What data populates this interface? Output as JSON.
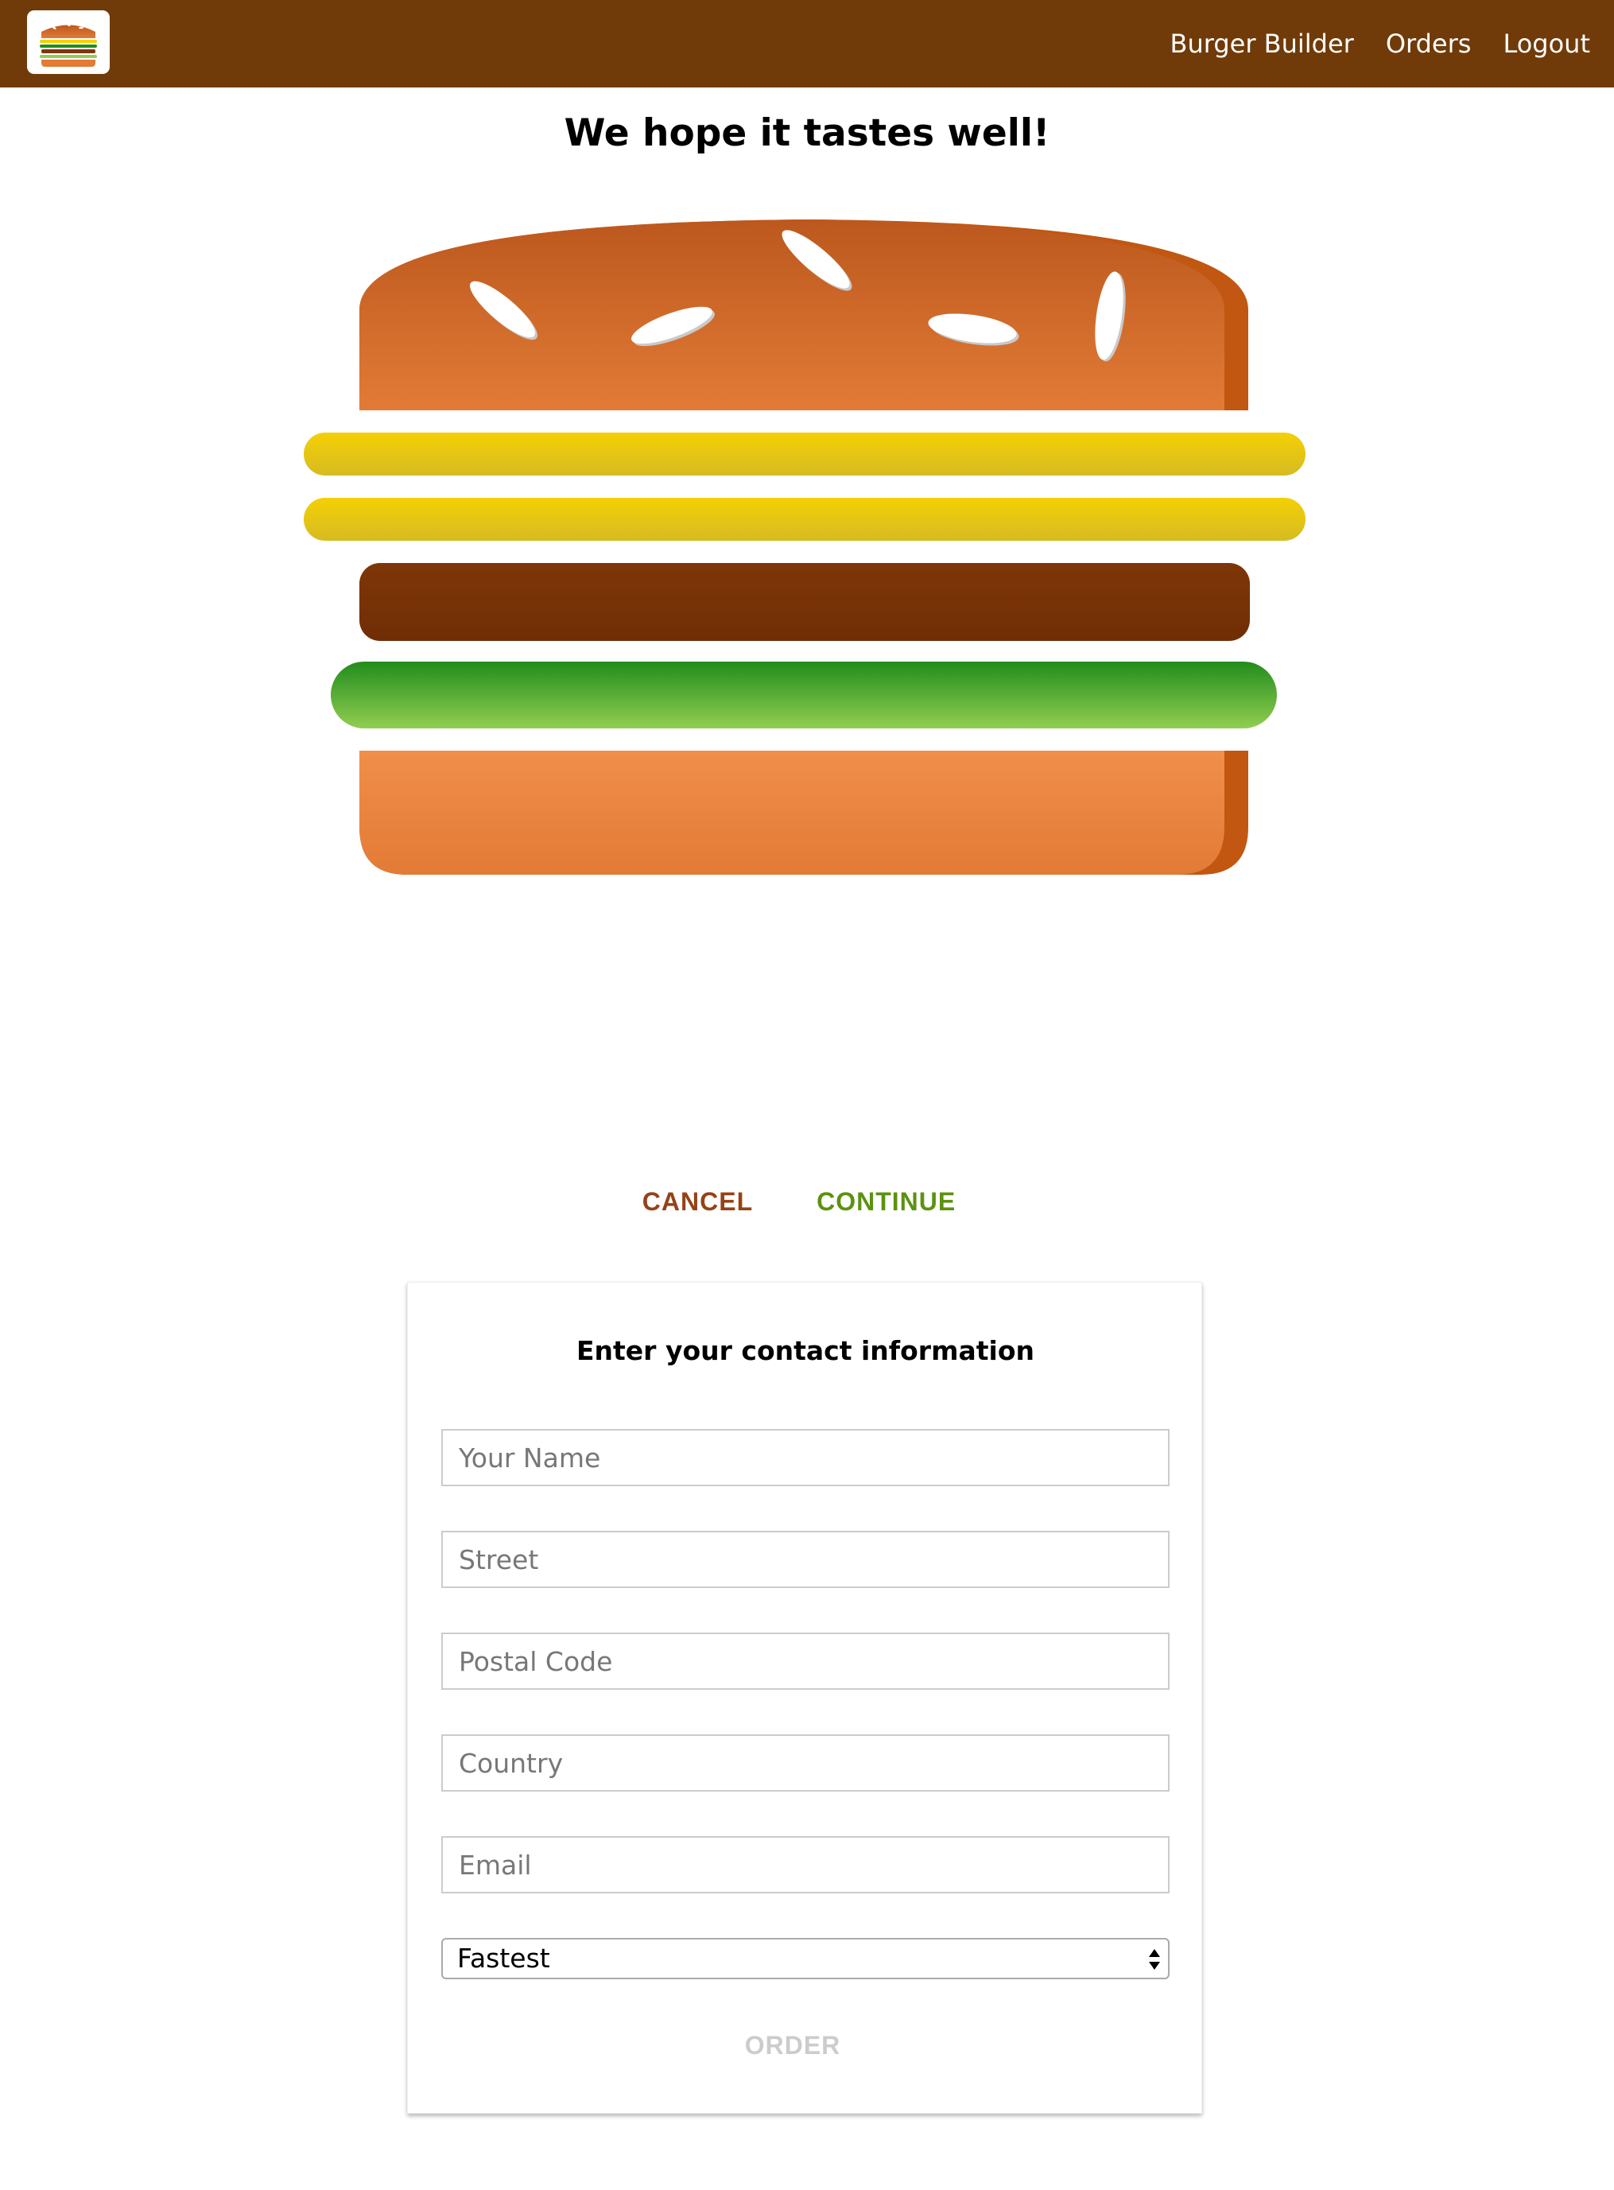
{
  "toolbar": {
    "logo_icon": "burger-logo-icon",
    "nav": [
      {
        "label": "Burger Builder"
      },
      {
        "label": "Orders"
      },
      {
        "label": "Logout"
      }
    ],
    "background": "#703b09"
  },
  "summary": {
    "heading": "We hope it tastes well!",
    "ingredients": [
      "bread-top",
      "cheese",
      "cheese",
      "meat",
      "salad",
      "bread-bottom"
    ],
    "cancel_label": "CANCEL",
    "continue_label": "CONTINUE"
  },
  "contact": {
    "title": "Enter your contact information",
    "fields": {
      "name": {
        "placeholder": "Your Name",
        "value": ""
      },
      "street": {
        "placeholder": "Street",
        "value": ""
      },
      "postal_code": {
        "placeholder": "Postal Code",
        "value": ""
      },
      "country": {
        "placeholder": "Country",
        "value": ""
      },
      "email": {
        "placeholder": "Email",
        "value": ""
      }
    },
    "delivery_method": {
      "selected": "Fastest"
    },
    "order_label": "ORDER"
  },
  "colors": {
    "brand": "#703b09",
    "cancel": "#944317",
    "continue": "#5c9210",
    "disabled": "#cccccc"
  }
}
